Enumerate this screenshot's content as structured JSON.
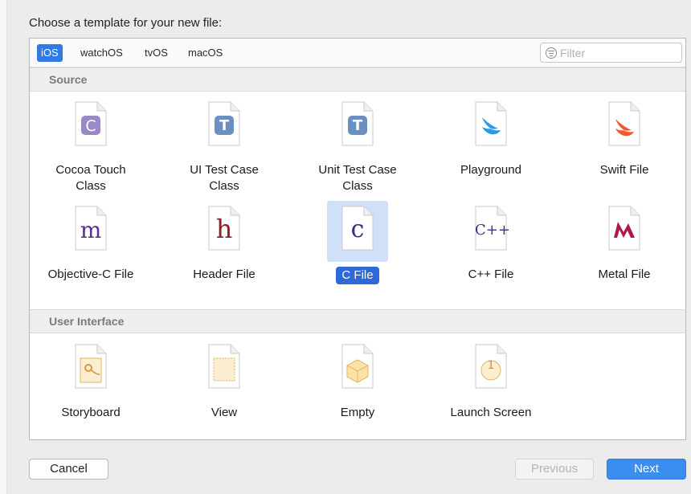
{
  "dialog": {
    "heading": "Choose a template for your new file:"
  },
  "platform_tabs": [
    {
      "label": "iOS",
      "selected": true
    },
    {
      "label": "watchOS",
      "selected": false
    },
    {
      "label": "tvOS",
      "selected": false
    },
    {
      "label": "macOS",
      "selected": false
    }
  ],
  "filter": {
    "placeholder": "Filter",
    "value": ""
  },
  "sections": [
    {
      "title": "Source",
      "items": [
        {
          "label_lines": [
            "Cocoa Touch",
            "Class"
          ],
          "icon": "cocoa-touch-class-icon",
          "glyph": "C"
        },
        {
          "label_lines": [
            "UI Test Case",
            "Class"
          ],
          "icon": "ui-test-case-class-icon",
          "glyph": "T"
        },
        {
          "label_lines": [
            "Unit Test Case",
            "Class"
          ],
          "icon": "unit-test-case-class-icon",
          "glyph": "T"
        },
        {
          "label_lines": [
            "Playground"
          ],
          "icon": "playground-icon"
        },
        {
          "label_lines": [
            "Swift File"
          ],
          "icon": "swift-file-icon"
        },
        {
          "label_lines": [
            "Objective-C File"
          ],
          "icon": "objective-c-file-icon",
          "glyph": "m"
        },
        {
          "label_lines": [
            "Header File"
          ],
          "icon": "header-file-icon",
          "glyph": "h"
        },
        {
          "label_lines": [
            "C File"
          ],
          "icon": "c-file-icon",
          "glyph": "c",
          "selected": true
        },
        {
          "label_lines": [
            "C++ File"
          ],
          "icon": "cpp-file-icon",
          "glyph": "C++"
        },
        {
          "label_lines": [
            "Metal File"
          ],
          "icon": "metal-file-icon"
        }
      ]
    },
    {
      "title": "User Interface",
      "items": [
        {
          "label_lines": [
            "Storyboard"
          ],
          "icon": "storyboard-icon"
        },
        {
          "label_lines": [
            "View"
          ],
          "icon": "view-icon"
        },
        {
          "label_lines": [
            "Empty"
          ],
          "icon": "empty-icon"
        },
        {
          "label_lines": [
            "Launch Screen"
          ],
          "icon": "launch-screen-icon",
          "glyph": "1"
        }
      ]
    }
  ],
  "buttons": {
    "cancel": "Cancel",
    "previous": "Previous",
    "next": "Next",
    "previous_enabled": false
  },
  "colors": {
    "selection": "#2f7ae5",
    "selected_item_bg": "#cfe0f8",
    "primary_button": "#3b8ef0",
    "cocoa_purple": "#9a88c7",
    "test_blue": "#6b8fc2",
    "swift_orange": "#f05a2e",
    "playground_blue": "#2d97e8",
    "objc_purple": "#5b2f8f",
    "header_red": "#8e2029",
    "c_indigo": "#3a2f7f",
    "metal_red": "#b0184a",
    "ui_gold": "#e2b560"
  }
}
